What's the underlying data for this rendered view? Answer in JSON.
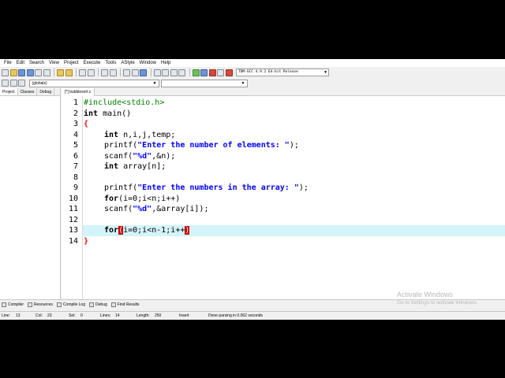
{
  "menu": [
    "File",
    "Edit",
    "Search",
    "View",
    "Project",
    "Execute",
    "Tools",
    "AStyle",
    "Window",
    "Help"
  ],
  "toolbar": {
    "icons": [
      "new-icon",
      "open-icon",
      "save-icon",
      "save-all-icon",
      "close-icon",
      "print-icon",
      "undo-icon",
      "redo-icon",
      "find-icon",
      "replace-icon",
      "indent-icon",
      "unindent-icon",
      "goto-back-icon",
      "goto-forward-icon",
      "bookmark-icon",
      "compile-icon",
      "run-icon",
      "compile-run-icon",
      "rebuild-icon",
      "check-icon",
      "debug-icon",
      "stop-icon",
      "profile-icon",
      "chart-icon"
    ],
    "compiler": "TDM-GCC 4.9.2 64-bit Release"
  },
  "scope": {
    "value": "(globals)"
  },
  "left_panel": {
    "tabs": [
      "Project",
      "Classes",
      "Debug"
    ]
  },
  "editor": {
    "file_tab": "[*] bubblesort.c",
    "line_numbers": [
      "1",
      "2",
      "3",
      "4",
      "5",
      "6",
      "7",
      "8",
      "9",
      "10",
      "11",
      "12",
      "13",
      "14"
    ],
    "code": {
      "l1": "#include<stdio.h>",
      "l2_kw": "int",
      "l2_rest": " main()",
      "l3": "{",
      "l4_kw": "int",
      "l4_rest": " n,i,j,temp;",
      "l5_a": "printf(",
      "l5_str": "\"Enter the number of elements: \"",
      "l5_b": ");",
      "l6_a": "scanf(",
      "l6_str": "\"%d\"",
      "l6_b": ",&n);",
      "l7_kw": "int",
      "l7_rest": " array[n];",
      "l9_a": "printf(",
      "l9_str": "\"Enter the numbers in the array: \"",
      "l9_b": ");",
      "l10_kw": "for",
      "l10_rest": "(i=0;i<n;i++)",
      "l11_a": "scanf(",
      "l11_str": "\"%d\"",
      "l11_b": ",&array[i]);",
      "l13_kw": "for",
      "l13_open": "(",
      "l13_mid": "i=0;i<n-1;i++",
      "l13_close": ")",
      "l14": "}"
    }
  },
  "bottom_tabs": [
    {
      "label": "Compiler",
      "icon": "compiler-icon"
    },
    {
      "label": "Resources",
      "icon": "resources-icon"
    },
    {
      "label": "Compile Log",
      "icon": "compile-log-icon"
    },
    {
      "label": "Debug",
      "icon": "debug-icon"
    },
    {
      "label": "Find Results",
      "icon": "find-results-icon"
    }
  ],
  "status": {
    "line_label": "Line:",
    "line": "13",
    "col_label": "Col:",
    "col": "23",
    "sel_label": "Sel:",
    "sel": "0",
    "lines_label": "Lines:",
    "lines": "14",
    "length_label": "Length:",
    "length": "250",
    "mode": "Insert",
    "message": "Done parsing in 0.062 seconds"
  },
  "watermark": {
    "title": "Activate Windows",
    "subtitle": "Go to Settings to activate Windows."
  },
  "colors": {
    "highlight": "#d3f4f8",
    "keyword": "#000000",
    "string": "#0000ff",
    "preprocessor": "#008000",
    "brace": "#ff0000",
    "bracket_match": "#c80000"
  }
}
